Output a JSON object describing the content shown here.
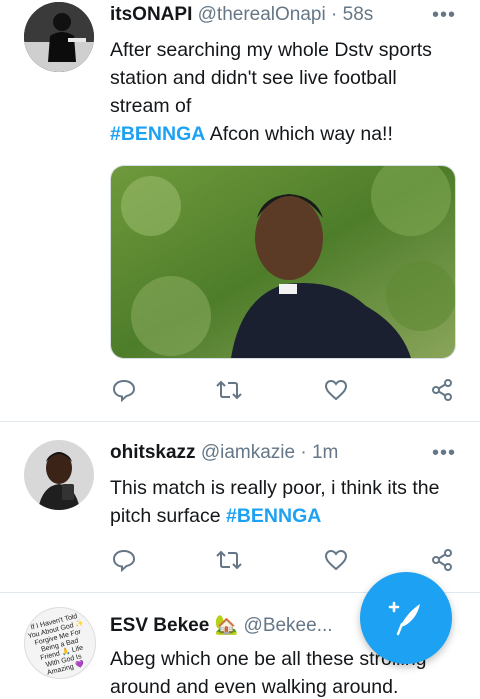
{
  "colors": {
    "accent": "#1da1f2",
    "text": "#14171a",
    "muted": "#657786",
    "divider": "#e1e8ed"
  },
  "tweets": [
    {
      "name": "itsONAPI",
      "handle": "@therealOnapi",
      "time": "· 58s",
      "more": "•••",
      "text_main": "After searching my whole Dstv sports station and didn't see live football stream of",
      "hashtag": "#BENNGA",
      "text_after": " Afcon which way na!!",
      "media_icon": "photo-man-in-priest-collar"
    },
    {
      "name": "ohitskazz",
      "handle": "@iamkazie",
      "time": "· 1m",
      "more": "•••",
      "text_main": "This match is really poor, i think its the pitch surface ",
      "hashtag": "#BENNGA"
    },
    {
      "name": "ESV Bekee",
      "emoji": "🏡",
      "handle": "@Bekee...",
      "text_main": "Abeg which one be all these strolling around and even walking around."
    }
  ],
  "avatar3_text": "If I Haven't Told You About God ✨ Forgive Me For Being a Bad Friend 🙏 Life With God Is Amazing 💜",
  "icons": [
    "reply-icon",
    "retweet-icon",
    "like-icon",
    "share-icon",
    "compose-tweet-icon"
  ]
}
